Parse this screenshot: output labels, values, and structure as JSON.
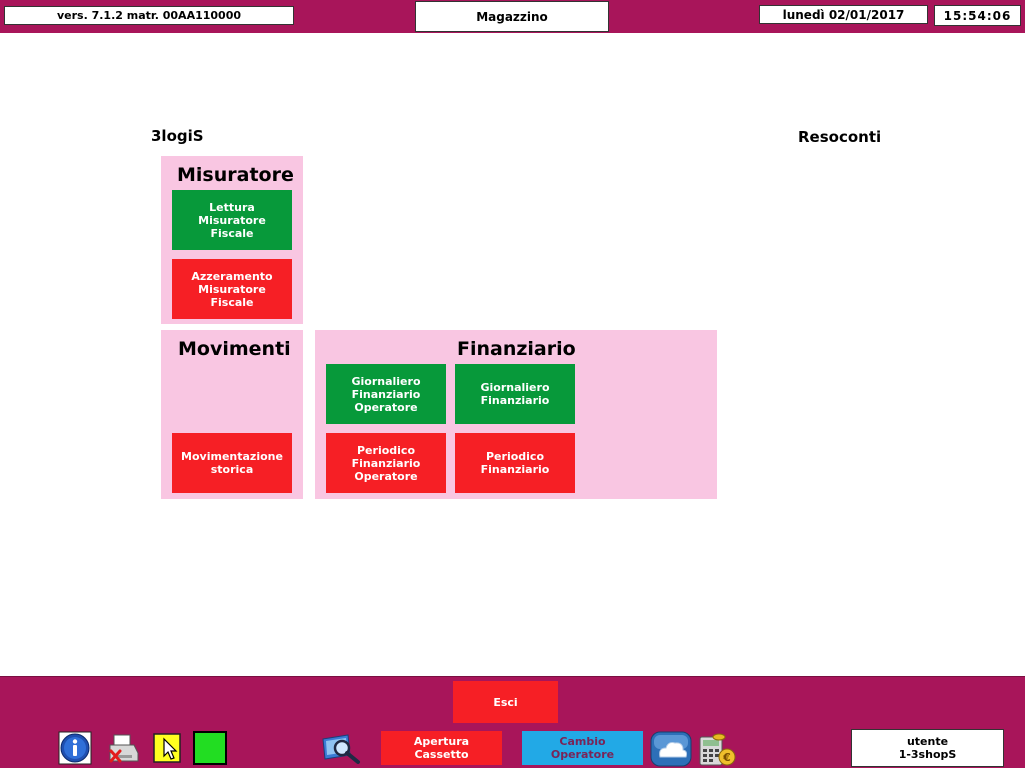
{
  "header": {
    "version": "vers. 7.1.2 matr. 00AA110000",
    "module": "Magazzino",
    "date": "lunedì 02/01/2017",
    "time": "15:54:06"
  },
  "brand": "3logiS",
  "section_title": "Resoconti",
  "panels": {
    "misuratore": {
      "title": "Misuratore",
      "buttons": [
        "Lettura\nMisuratore\nFiscale",
        "Azzeramento\nMisuratore\nFiscale"
      ]
    },
    "movimenti": {
      "title": "Movimenti",
      "buttons": [
        "Movimentazione\nstorica"
      ]
    },
    "finanziario": {
      "title": "Finanziario",
      "buttons": [
        "Giornaliero\nFinanziario\nOperatore",
        "Giornaliero\nFinanziario",
        "Periodico\nFinanziario\nOperatore",
        "Periodico\nFinanziario"
      ]
    }
  },
  "footer": {
    "exit": "Esci"
  },
  "taskbar": {
    "drawer": "Apertura\nCassetto",
    "operator": "Cambio\nOperatore",
    "user": "utente\n1-3shopS",
    "icons": [
      "info-icon",
      "printer-cancel-icon",
      "cursor-icon",
      "status-square-icon",
      "search-icon",
      "cloud-icon",
      "calculator-euro-icon"
    ]
  },
  "colors": {
    "bar": "#a8155a",
    "panel": "#f9c6e2",
    "green": "#07993a",
    "red": "#f61f25",
    "cyan": "#22a9e6"
  }
}
